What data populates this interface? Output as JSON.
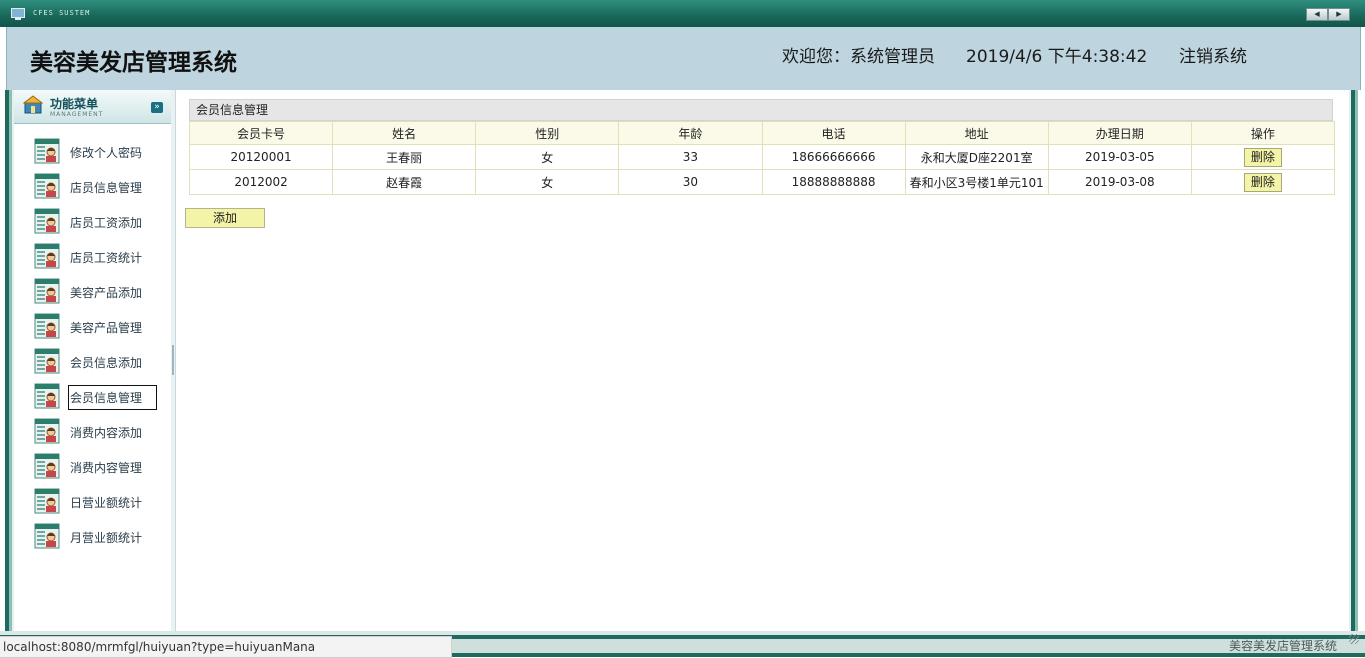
{
  "window": {
    "system_label": "CFES SUSTEM",
    "nav_prev": "◀",
    "nav_next": "▶"
  },
  "header": {
    "title": "美容美发店管理系统",
    "welcome": "欢迎您：系统管理员",
    "datetime": "2019/4/6 下午4:38:42",
    "logout": "注销系统"
  },
  "sidebar": {
    "menu_title": "功能菜单",
    "menu_subtitle": "MANAGEMENT",
    "collapse_glyph": "»",
    "items": [
      {
        "label": "修改个人密码"
      },
      {
        "label": "店员信息管理"
      },
      {
        "label": "店员工资添加"
      },
      {
        "label": "店员工资统计"
      },
      {
        "label": "美容产品添加"
      },
      {
        "label": "美容产品管理"
      },
      {
        "label": "会员信息添加"
      },
      {
        "label": "会员信息管理"
      },
      {
        "label": "消费内容添加"
      },
      {
        "label": "消费内容管理"
      },
      {
        "label": "日营业额统计"
      },
      {
        "label": "月营业额统计"
      }
    ],
    "active_index": 7
  },
  "content": {
    "panel_title": "会员信息管理",
    "columns": [
      "会员卡号",
      "姓名",
      "性别",
      "年龄",
      "电话",
      "地址",
      "办理日期",
      "操作"
    ],
    "rows": [
      {
        "card": "20120001",
        "name": "王春丽",
        "gender": "女",
        "age": "33",
        "phone": "18666666666",
        "address": "永和大厦D座2201室",
        "date": "2019-03-05",
        "action": "删除"
      },
      {
        "card": "2012002",
        "name": "赵春霞",
        "gender": "女",
        "age": "30",
        "phone": "18888888888",
        "address": "春和小区3号楼1单元101",
        "date": "2019-03-08",
        "action": "删除"
      }
    ],
    "add_label": "添加"
  },
  "footer": {
    "text": "美容美发店管理系统"
  },
  "statusbar": {
    "url": "localhost:8080/mrmfgl/huiyuan?type=huiyuanMana"
  },
  "colors": {
    "frame": "#1e6a5e",
    "header_bg": "#bed4df",
    "button_bg": "#f4f4a8"
  }
}
